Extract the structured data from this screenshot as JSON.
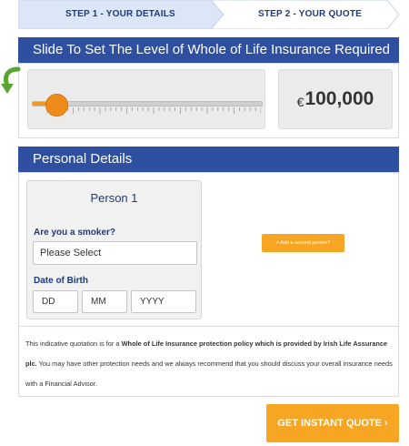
{
  "steps": [
    {
      "label": "STEP 1 - YOUR DETAILS",
      "active": true
    },
    {
      "label": "STEP 2 - YOUR QUOTE",
      "active": false
    }
  ],
  "slider_section": {
    "title": "Slide To Set The Level of Whole of Life Insurance Required",
    "slider_level_fraction": 0.11,
    "currency_symbol": "€",
    "amount": "100,000"
  },
  "personal_details": {
    "title": "Personal Details",
    "person": {
      "title": "Person 1",
      "smoker_label": "Are you a smoker?",
      "smoker_value": "Please Select",
      "dob_label": "Date of Birth",
      "dob_day_placeholder": "DD",
      "dob_month_placeholder": "MM",
      "dob_year_placeholder": "YYYY"
    },
    "add_person_label": "+ Add a second person?",
    "disclaimer": {
      "part1": "This indicative quotation is for a ",
      "bold1": "Whole of Life Insurance protection policy which is provided by Irish Life Assurance plc.",
      "part2": " You may have other protection needs and we always recommend that you should discuss your overall insurance needs with a Financial Advisor."
    }
  },
  "cta_label": "GET INSTANT QUOTE ›",
  "colors": {
    "header_blue": "#2f4fa0",
    "step_active_bg": "#dbe7f8",
    "accent_orange": "#f6a623",
    "label_blue": "#1f3a7a",
    "arrow_green": "#5aa532"
  }
}
